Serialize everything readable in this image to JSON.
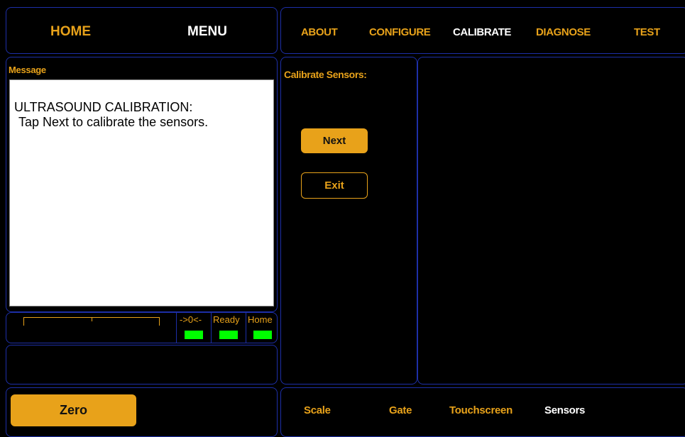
{
  "header_left": {
    "home_label": "HOME",
    "menu_label": "MENU"
  },
  "top_nav": {
    "items": [
      {
        "label": "ABOUT",
        "active": false
      },
      {
        "label": "CONFIGURE",
        "active": false
      },
      {
        "label": "CALIBRATE",
        "active": true
      },
      {
        "label": "DIAGNOSE",
        "active": false
      },
      {
        "label": "TEST",
        "active": false
      }
    ]
  },
  "message": {
    "title": "Message",
    "line1": "ULTRASOUND CALIBRATION:",
    "line2": "Tap Next to calibrate the sensors."
  },
  "status": {
    "indicators": [
      {
        "label": "->0<-",
        "color": "#00ff00"
      },
      {
        "label": "Ready",
        "color": "#00ff00"
      },
      {
        "label": "Home",
        "color": "#00ff00"
      }
    ]
  },
  "calibrate": {
    "heading": "Calibrate Sensors:",
    "next_label": "Next",
    "exit_label": "Exit"
  },
  "bottom": {
    "zero_label": "Zero",
    "tabs": [
      {
        "label": "Scale",
        "active": false
      },
      {
        "label": "Gate",
        "active": false
      },
      {
        "label": "Touchscreen",
        "active": false
      },
      {
        "label": "Sensors",
        "active": true
      }
    ]
  },
  "colors": {
    "accent": "#e8a21a",
    "border": "#1d2fa8",
    "led_on": "#00ff00",
    "background": "#000000"
  }
}
